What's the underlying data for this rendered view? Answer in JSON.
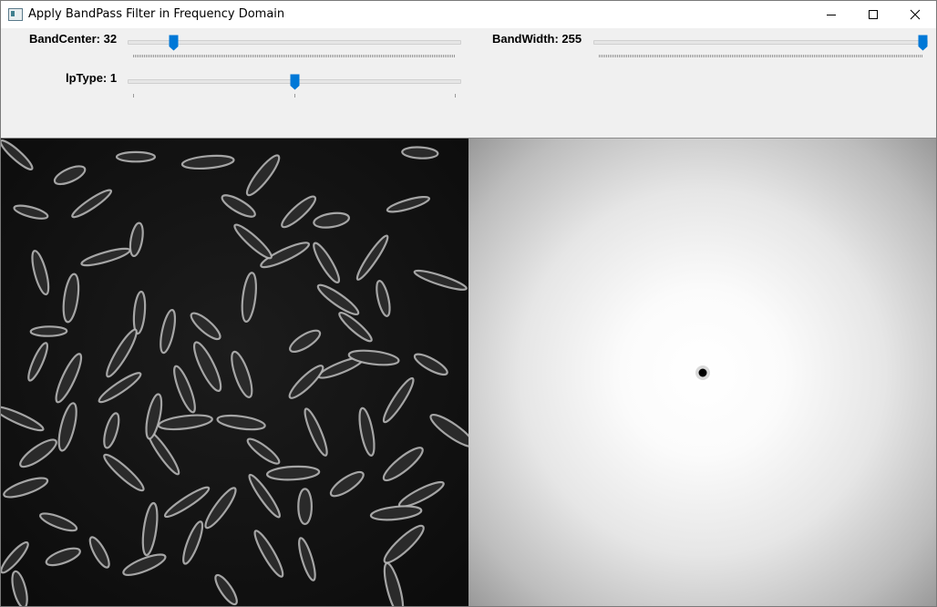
{
  "window": {
    "title": "Apply BandPass Filter in Frequency Domain"
  },
  "controls": {
    "band_center": {
      "label": "BandCenter: 32",
      "value": 32,
      "max": 255
    },
    "band_width": {
      "label": "BandWidth: 255",
      "value": 255,
      "max": 255
    },
    "lp_type": {
      "label": "lpType: 1",
      "value": 1,
      "max": 2
    }
  },
  "colors": {
    "thumb": "#0078d7",
    "title_bg": "#ffffff",
    "panel_bg": "#f0f0f0"
  },
  "icons": {
    "app": "app-window-icon",
    "minimize": "minimize-icon",
    "maximize": "maximize-icon",
    "close": "close-icon"
  }
}
